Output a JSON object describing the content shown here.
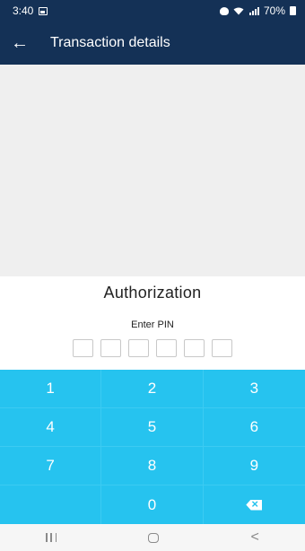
{
  "status_bar": {
    "time": "3:40",
    "battery": "70%"
  },
  "app_bar": {
    "title": "Transaction details",
    "back_icon": "arrow-left-icon"
  },
  "authorization": {
    "title": "Authorization",
    "pin_label": "Enter PIN",
    "pin_length": 6
  },
  "keypad": {
    "keys": [
      "1",
      "2",
      "3",
      "4",
      "5",
      "6",
      "7",
      "8",
      "9",
      "",
      "0",
      "backspace"
    ]
  },
  "colors": {
    "header": "#143156",
    "keypad": "#26c3ef",
    "details_bg": "#efefef"
  }
}
